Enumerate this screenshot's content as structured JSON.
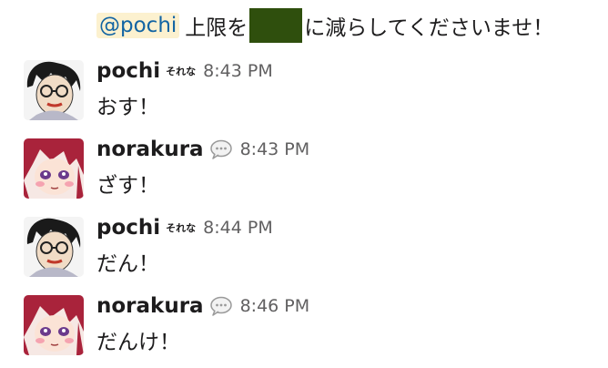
{
  "top_message": {
    "mention": "@pochi",
    "text_before": "上限を",
    "text_after": "に減らしてくださいませ！"
  },
  "messages": [
    {
      "sender": "pochi",
      "status_text": "それな",
      "status_icon": "",
      "time": "8:43 PM",
      "text": "おす！"
    },
    {
      "sender": "norakura",
      "status_text": "",
      "status_icon": "speech-bubble-icon",
      "time": "8:43 PM",
      "text": "ざす！"
    },
    {
      "sender": "pochi",
      "status_text": "それな",
      "status_icon": "",
      "time": "8:44 PM",
      "text": "だん！"
    },
    {
      "sender": "norakura",
      "status_text": "",
      "status_icon": "speech-bubble-icon",
      "time": "8:46 PM",
      "text": "だんけ！"
    }
  ],
  "colors": {
    "mention_text": "#1264a3",
    "mention_bg": "#fcf1cf",
    "redaction": "#2f4f0d",
    "timestamp": "#616061"
  }
}
